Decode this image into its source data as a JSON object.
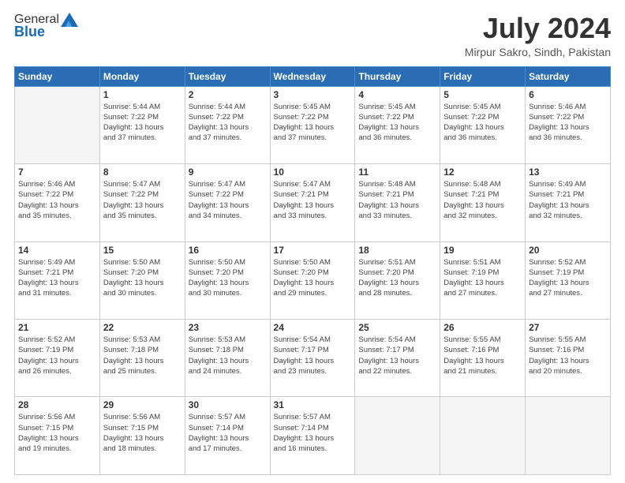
{
  "logo": {
    "general": "General",
    "blue": "Blue"
  },
  "title": {
    "month_year": "July 2024",
    "location": "Mirpur Sakro, Sindh, Pakistan"
  },
  "days_of_week": [
    "Sunday",
    "Monday",
    "Tuesday",
    "Wednesday",
    "Thursday",
    "Friday",
    "Saturday"
  ],
  "weeks": [
    {
      "days": [
        {
          "num": "",
          "info": ""
        },
        {
          "num": "1",
          "info": "Sunrise: 5:44 AM\nSunset: 7:22 PM\nDaylight: 13 hours\nand 37 minutes."
        },
        {
          "num": "2",
          "info": "Sunrise: 5:44 AM\nSunset: 7:22 PM\nDaylight: 13 hours\nand 37 minutes."
        },
        {
          "num": "3",
          "info": "Sunrise: 5:45 AM\nSunset: 7:22 PM\nDaylight: 13 hours\nand 37 minutes."
        },
        {
          "num": "4",
          "info": "Sunrise: 5:45 AM\nSunset: 7:22 PM\nDaylight: 13 hours\nand 36 minutes."
        },
        {
          "num": "5",
          "info": "Sunrise: 5:45 AM\nSunset: 7:22 PM\nDaylight: 13 hours\nand 36 minutes."
        },
        {
          "num": "6",
          "info": "Sunrise: 5:46 AM\nSunset: 7:22 PM\nDaylight: 13 hours\nand 36 minutes."
        }
      ]
    },
    {
      "days": [
        {
          "num": "7",
          "info": "Sunrise: 5:46 AM\nSunset: 7:22 PM\nDaylight: 13 hours\nand 35 minutes."
        },
        {
          "num": "8",
          "info": "Sunrise: 5:47 AM\nSunset: 7:22 PM\nDaylight: 13 hours\nand 35 minutes."
        },
        {
          "num": "9",
          "info": "Sunrise: 5:47 AM\nSunset: 7:22 PM\nDaylight: 13 hours\nand 34 minutes."
        },
        {
          "num": "10",
          "info": "Sunrise: 5:47 AM\nSunset: 7:21 PM\nDaylight: 13 hours\nand 33 minutes."
        },
        {
          "num": "11",
          "info": "Sunrise: 5:48 AM\nSunset: 7:21 PM\nDaylight: 13 hours\nand 33 minutes."
        },
        {
          "num": "12",
          "info": "Sunrise: 5:48 AM\nSunset: 7:21 PM\nDaylight: 13 hours\nand 32 minutes."
        },
        {
          "num": "13",
          "info": "Sunrise: 5:49 AM\nSunset: 7:21 PM\nDaylight: 13 hours\nand 32 minutes."
        }
      ]
    },
    {
      "days": [
        {
          "num": "14",
          "info": "Sunrise: 5:49 AM\nSunset: 7:21 PM\nDaylight: 13 hours\nand 31 minutes."
        },
        {
          "num": "15",
          "info": "Sunrise: 5:50 AM\nSunset: 7:20 PM\nDaylight: 13 hours\nand 30 minutes."
        },
        {
          "num": "16",
          "info": "Sunrise: 5:50 AM\nSunset: 7:20 PM\nDaylight: 13 hours\nand 30 minutes."
        },
        {
          "num": "17",
          "info": "Sunrise: 5:50 AM\nSunset: 7:20 PM\nDaylight: 13 hours\nand 29 minutes."
        },
        {
          "num": "18",
          "info": "Sunrise: 5:51 AM\nSunset: 7:20 PM\nDaylight: 13 hours\nand 28 minutes."
        },
        {
          "num": "19",
          "info": "Sunrise: 5:51 AM\nSunset: 7:19 PM\nDaylight: 13 hours\nand 27 minutes."
        },
        {
          "num": "20",
          "info": "Sunrise: 5:52 AM\nSunset: 7:19 PM\nDaylight: 13 hours\nand 27 minutes."
        }
      ]
    },
    {
      "days": [
        {
          "num": "21",
          "info": "Sunrise: 5:52 AM\nSunset: 7:19 PM\nDaylight: 13 hours\nand 26 minutes."
        },
        {
          "num": "22",
          "info": "Sunrise: 5:53 AM\nSunset: 7:18 PM\nDaylight: 13 hours\nand 25 minutes."
        },
        {
          "num": "23",
          "info": "Sunrise: 5:53 AM\nSunset: 7:18 PM\nDaylight: 13 hours\nand 24 minutes."
        },
        {
          "num": "24",
          "info": "Sunrise: 5:54 AM\nSunset: 7:17 PM\nDaylight: 13 hours\nand 23 minutes."
        },
        {
          "num": "25",
          "info": "Sunrise: 5:54 AM\nSunset: 7:17 PM\nDaylight: 13 hours\nand 22 minutes."
        },
        {
          "num": "26",
          "info": "Sunrise: 5:55 AM\nSunset: 7:16 PM\nDaylight: 13 hours\nand 21 minutes."
        },
        {
          "num": "27",
          "info": "Sunrise: 5:55 AM\nSunset: 7:16 PM\nDaylight: 13 hours\nand 20 minutes."
        }
      ]
    },
    {
      "days": [
        {
          "num": "28",
          "info": "Sunrise: 5:56 AM\nSunset: 7:15 PM\nDaylight: 13 hours\nand 19 minutes."
        },
        {
          "num": "29",
          "info": "Sunrise: 5:56 AM\nSunset: 7:15 PM\nDaylight: 13 hours\nand 18 minutes."
        },
        {
          "num": "30",
          "info": "Sunrise: 5:57 AM\nSunset: 7:14 PM\nDaylight: 13 hours\nand 17 minutes."
        },
        {
          "num": "31",
          "info": "Sunrise: 5:57 AM\nSunset: 7:14 PM\nDaylight: 13 hours\nand 16 minutes."
        },
        {
          "num": "",
          "info": ""
        },
        {
          "num": "",
          "info": ""
        },
        {
          "num": "",
          "info": ""
        }
      ]
    }
  ]
}
